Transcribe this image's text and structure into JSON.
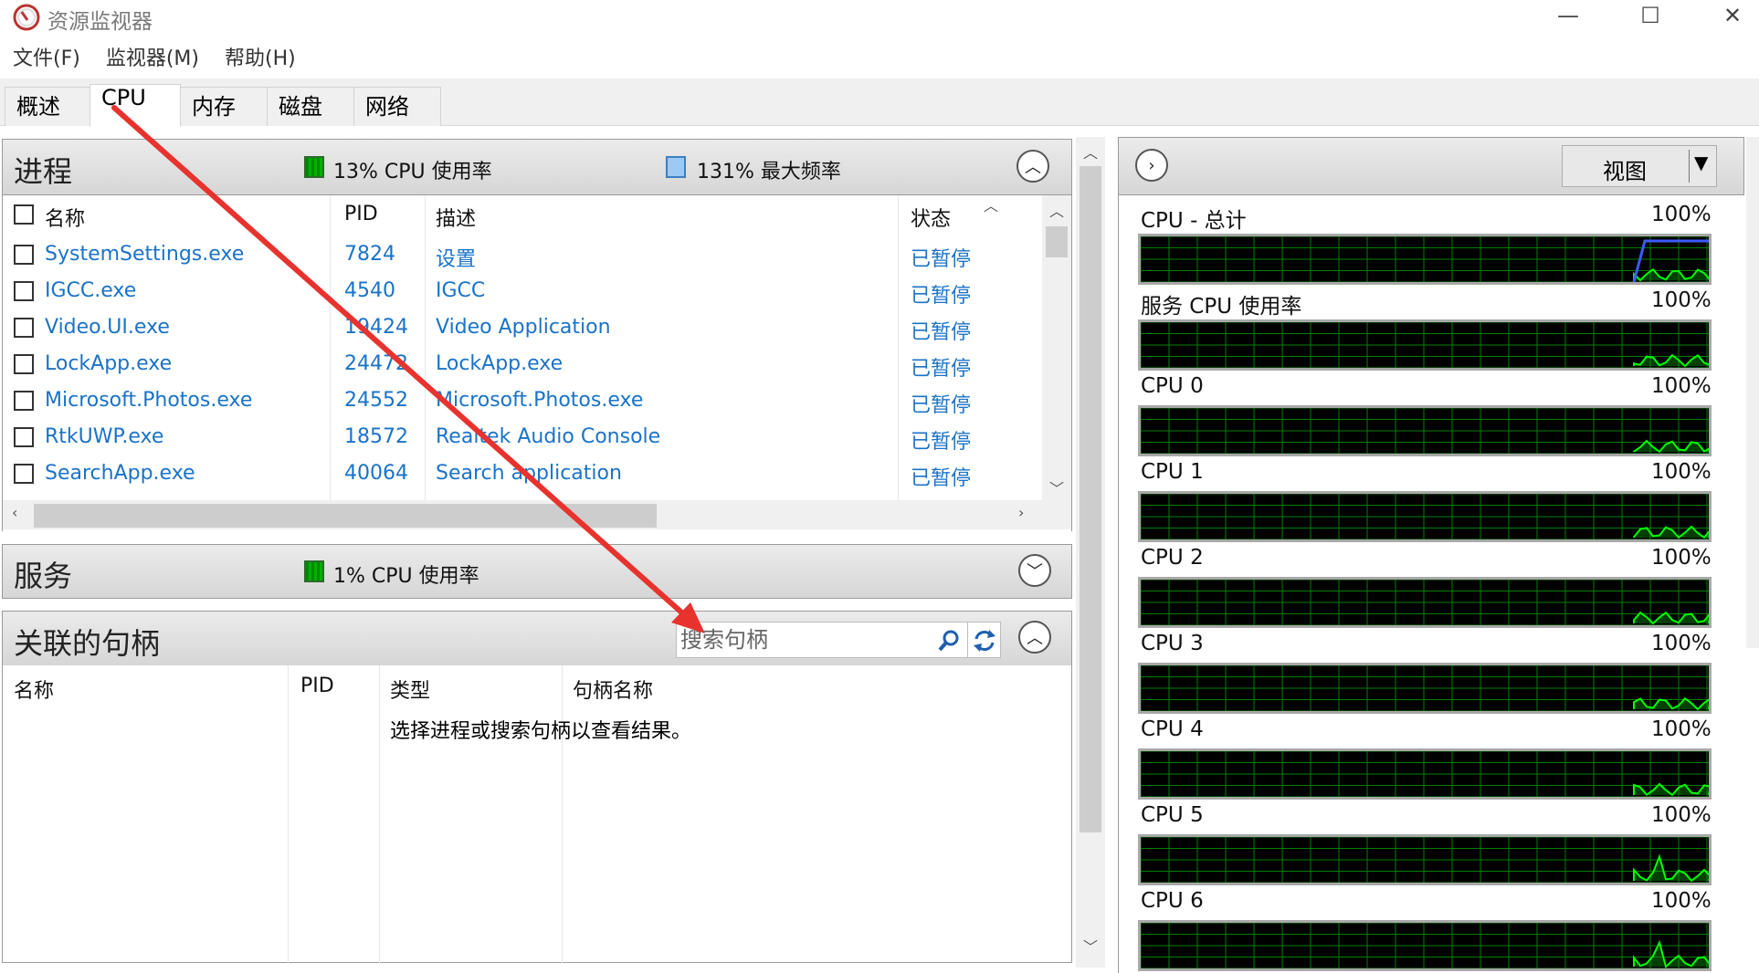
{
  "window": {
    "title": "资源监视器",
    "minimize_glyph": "—",
    "maximize_glyph": "☐",
    "close_glyph": "✕"
  },
  "menu": [
    "文件(F)",
    "监视器(M)",
    "帮助(H)"
  ],
  "tabs": [
    {
      "label": "概述",
      "active": false
    },
    {
      "label": "CPU",
      "active": true
    },
    {
      "label": "内存",
      "active": false
    },
    {
      "label": "磁盘",
      "active": false
    },
    {
      "label": "网络",
      "active": false
    }
  ],
  "processes": {
    "title": "进程",
    "cpu_usage": "13% CPU 使用率",
    "max_freq": "131% 最大频率",
    "columns": [
      "名称",
      "PID",
      "描述",
      "状态"
    ],
    "rows": [
      {
        "name": "SystemSettings.exe",
        "pid": "7824",
        "desc": "设置",
        "status": "已暂停"
      },
      {
        "name": "IGCC.exe",
        "pid": "4540",
        "desc": "IGCC",
        "status": "已暂停"
      },
      {
        "name": "Video.UI.exe",
        "pid": "19424",
        "desc": "Video Application",
        "status": "已暂停"
      },
      {
        "name": "LockApp.exe",
        "pid": "24472",
        "desc": "LockApp.exe",
        "status": "已暂停"
      },
      {
        "name": "Microsoft.Photos.exe",
        "pid": "24552",
        "desc": "Microsoft.Photos.exe",
        "status": "已暂停"
      },
      {
        "name": "RtkUWP.exe",
        "pid": "18572",
        "desc": "Realtek Audio Console",
        "status": "已暂停"
      },
      {
        "name": "SearchApp.exe",
        "pid": "40064",
        "desc": "Search application",
        "status": "已暂停"
      }
    ]
  },
  "services": {
    "title": "服务",
    "cpu_usage": "1% CPU 使用率"
  },
  "handles": {
    "title": "关联的句柄",
    "search_placeholder": "搜索句柄",
    "columns": [
      "名称",
      "PID",
      "类型",
      "句柄名称"
    ],
    "empty_message": "选择进程或搜索句柄以查看结果。"
  },
  "graphs_panel": {
    "view_label": "视图",
    "graphs": [
      {
        "label": "CPU - 总计",
        "pct": "100%",
        "blue_level": 0.9
      },
      {
        "label": "服务 CPU 使用率",
        "pct": "100%"
      },
      {
        "label": "CPU 0",
        "pct": "100%"
      },
      {
        "label": "CPU 1",
        "pct": "100%"
      },
      {
        "label": "CPU 2",
        "pct": "100%"
      },
      {
        "label": "CPU 3",
        "pct": "100%"
      },
      {
        "label": "CPU 4",
        "pct": "100%"
      },
      {
        "label": "CPU 5",
        "pct": "100%"
      },
      {
        "label": "CPU 6",
        "pct": "100%"
      }
    ]
  },
  "colors": {
    "link_blue": "#1a73c8",
    "graph_grid": "#008000",
    "graph_line": "#00ff00",
    "max_freq_line": "#3b5bff",
    "annotation_red": "#e8322d"
  }
}
